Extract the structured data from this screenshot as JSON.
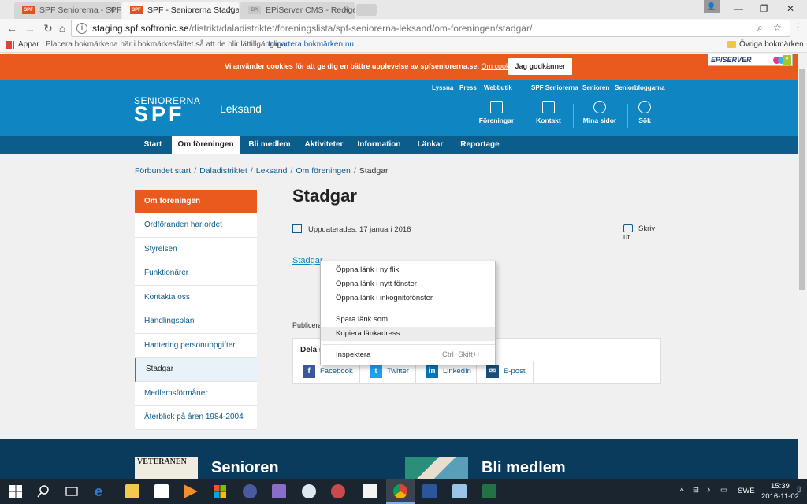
{
  "browser": {
    "tabs": [
      {
        "label": "SPF Seniorerna - SPF Se",
        "favicon": "SPF",
        "active": false
      },
      {
        "label": "SPF - Seniorerna Stadgar",
        "favicon": "SPF",
        "active": true
      },
      {
        "label": "EPiServer CMS - Redige",
        "favicon": "EPi",
        "active": false
      }
    ],
    "url_host": "staging.spf.softronic.se",
    "url_path": "/distrikt/daladistriktet/foreningslista/spf-seniorerna-leksand/om-foreningen/stadgar/",
    "bookmarks": {
      "apps": "Appar",
      "hint": "Placera bokmärkena här i bokmärkesfältet så att de blir lättillgängliga.",
      "import": "Importera bokmärken nu...",
      "other": "Övriga bokmärken"
    }
  },
  "cookie": {
    "message": "Vi använder cookies för att ge dig en bättre upplevelse av spfseniorerna.se.",
    "link": "Om cookies",
    "accept": "Jag godkänner"
  },
  "episerver": {
    "logo": "EPISERVER"
  },
  "header": {
    "toplinks": [
      "Lyssna",
      "Press",
      "Webbutik",
      "SPF Seniorerna",
      "Senioren",
      "Seniorbloggarna"
    ],
    "logo_small": "SENIORERNA",
    "logo_big": "SPF",
    "place": "Leksand",
    "nav": [
      {
        "label": "Föreningar",
        "icon": "building-icon"
      },
      {
        "label": "Kontakt",
        "icon": "envelope-icon"
      },
      {
        "label": "Mina sidor",
        "icon": "user-icon"
      },
      {
        "label": "Sök",
        "icon": "search-icon"
      }
    ]
  },
  "mainnav": [
    "Start",
    "Om föreningen",
    "Bli medlem",
    "Aktiviteter",
    "Information",
    "Länkar",
    "Reportage"
  ],
  "breadcrumb": [
    "Förbundet start",
    "Daladistriktet",
    "Leksand",
    "Om föreningen",
    "Stadgar"
  ],
  "sidebar": {
    "heading": "Om föreningen",
    "items": [
      "Ordföranden har ordet",
      "Styrelsen",
      "Funktionärer",
      "Kontakta oss",
      "Handlingsplan",
      "Hantering personuppgifter",
      "Stadgar",
      "Medlemsförmåner",
      "Återblick på åren 1984-2004"
    ]
  },
  "content": {
    "title": "Stadgar",
    "updated": "Uppdaterades: 17 januari 2016",
    "print": "Skriv ut",
    "doc_link": "Stadgar",
    "published": "Publicera",
    "share_label": "Dela s",
    "share": [
      "Facebook",
      "Twitter",
      "LinkedIn",
      "E-post"
    ]
  },
  "context_menu": {
    "items": [
      {
        "label": "Öppna länk i ny flik",
        "shortcut": ""
      },
      {
        "label": "Öppna länk i nytt fönster",
        "shortcut": ""
      },
      {
        "label": "Öppna länk i inkognitofönster",
        "shortcut": ""
      },
      {
        "label": "Spara länk som...",
        "shortcut": ""
      },
      {
        "label": "Kopiera länkadress",
        "shortcut": ""
      },
      {
        "label": "Inspektera",
        "shortcut": "Ctrl+Skift+I"
      }
    ]
  },
  "footer": {
    "titles": [
      "Senioren",
      "Bli medlem"
    ],
    "magazine": "VETERANEN"
  },
  "taskbar": {
    "lang": "SWE",
    "time": "15:39",
    "date": "2016-11-02"
  },
  "colors": {
    "orange": "#e95a1e",
    "blue": "#0f86c1",
    "darkblue": "#0b5e8c",
    "footer": "#0a3a5c"
  }
}
